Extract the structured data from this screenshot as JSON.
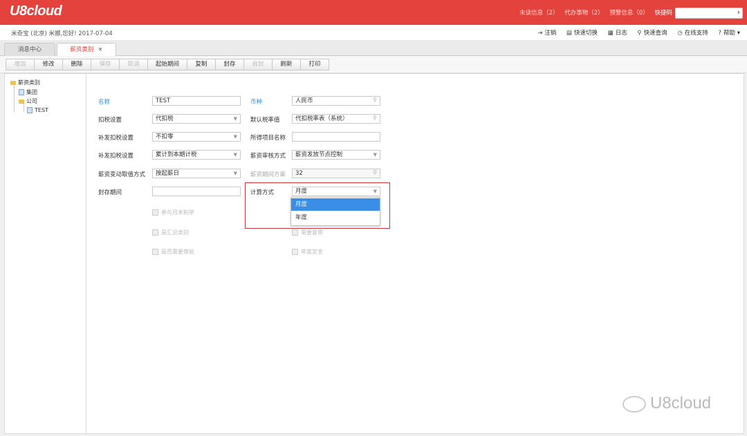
{
  "header": {
    "logo": "U8cloud",
    "links": [
      "未读信息（2）",
      "代办事物（2）",
      "预警信息（0）"
    ],
    "quick_label": "快捷码"
  },
  "infobar": {
    "user": "米奇宝 (北京) 米娜,您好! 2017-07-04",
    "tools": [
      "注销",
      "快速切换",
      "日志",
      "快速查询",
      "在线支持",
      "帮助"
    ]
  },
  "tabs": [
    {
      "label": "消息中心"
    },
    {
      "label": "薪资类别",
      "close": "×"
    }
  ],
  "toolbar": [
    "增加",
    "修改",
    "删除",
    "保存",
    "取消",
    "起始期间",
    "复制",
    "封存",
    "启封",
    "刷新",
    "打印"
  ],
  "tree": {
    "root": "薪资类别",
    "items": [
      "集团",
      "公司",
      "TEST"
    ]
  },
  "form": {
    "name_label": "名称",
    "name_value": "TEST",
    "currency_label": "币种",
    "currency_value": "人民币",
    "tax_label": "扣税设置",
    "tax_value": "代扣税",
    "default_rate_label": "默认税率值",
    "default_rate_value": "代扣税率表（系统）",
    "supp_label": "补发扣税设置",
    "supp_value": "不扣零",
    "income_label": "所得项目名称",
    "income_value": "",
    "supp2_label": "补发扣税设置",
    "supp2_value": "累计到本期计税",
    "audit_label": "薪资审核方式",
    "audit_value": "薪资发放节点控制",
    "change_label": "薪资变动取值方式",
    "change_value": "按起薪日",
    "period_plan_label": "薪资期间方案",
    "period_plan_value": "32",
    "seal_label": "封存期间",
    "seal_value": "",
    "calc_label": "计算方式",
    "calc_value": "月度",
    "calc_options": [
      "月度",
      "年度"
    ],
    "checks": [
      "参与月末制单",
      "是汇总类别",
      "是否需要审批",
      "需要复审",
      "年度奖金"
    ]
  },
  "watermark": "U8cloud"
}
